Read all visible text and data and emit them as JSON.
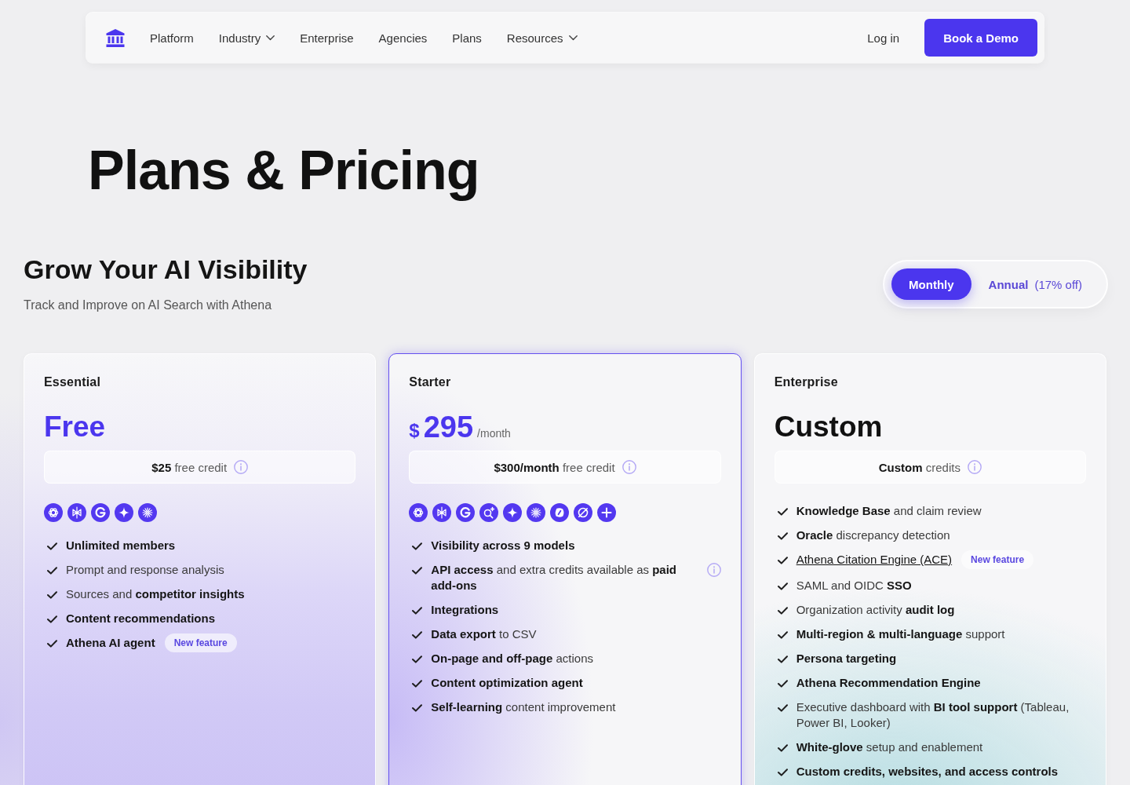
{
  "nav": {
    "links": [
      {
        "label": "Platform",
        "has_menu": false
      },
      {
        "label": "Industry",
        "has_menu": true
      },
      {
        "label": "Enterprise",
        "has_menu": false
      },
      {
        "label": "Agencies",
        "has_menu": false
      },
      {
        "label": "Plans",
        "has_menu": false
      },
      {
        "label": "Resources",
        "has_menu": true
      }
    ],
    "login": "Log in",
    "cta": "Book a Demo"
  },
  "page_title": "Plans & Pricing",
  "section": {
    "title": "Grow Your AI Visibility",
    "subtitle": "Track and Improve on AI Search with Athena"
  },
  "billing_toggle": [
    {
      "label": "Monthly",
      "selected": true
    },
    {
      "label": "Annual",
      "note": "(17% off)",
      "selected": false
    }
  ],
  "plans": [
    {
      "name": "Essential",
      "highlighted": false,
      "price": {
        "kind": "label",
        "value": "Free",
        "accent": true
      },
      "credit": "**$25** free credit",
      "models": [
        {
          "kind": "knot"
        },
        {
          "kind": "lattice"
        },
        {
          "kind": "g-mark"
        },
        {
          "kind": "star"
        },
        {
          "kind": "burst"
        }
      ],
      "features": [
        {
          "kind": "strong",
          "text": "Unlimited members",
          "info": false
        },
        {
          "kind": "text",
          "text": "Prompt and response analysis",
          "info": false
        },
        {
          "kind": "text",
          "text": "Sources and **competitor insights**",
          "info": false
        },
        {
          "kind": "strong",
          "text": "Content recommendations",
          "info": false
        },
        {
          "kind": "strong",
          "text": "Athena AI agent",
          "info": false,
          "badge": "New feature"
        }
      ]
    },
    {
      "name": "Starter",
      "highlighted": true,
      "price": {
        "kind": "amount",
        "currency": "$",
        "value": "295",
        "period": "/month",
        "accent": true
      },
      "credit": "**$300/month** free credit",
      "models": [
        {
          "kind": "knot"
        },
        {
          "kind": "lattice"
        },
        {
          "kind": "g-mark"
        },
        {
          "kind": "magnifier"
        },
        {
          "kind": "star"
        },
        {
          "kind": "burst"
        },
        {
          "kind": "blob"
        },
        {
          "kind": "slashed"
        },
        {
          "kind": "plus"
        }
      ],
      "features": [
        {
          "kind": "strong",
          "text": "Visibility across 9 models",
          "info": false
        },
        {
          "kind": "text",
          "text": "**API access** and extra credits available as **paid add-ons**",
          "info": true
        },
        {
          "kind": "strong",
          "text": "Integrations",
          "info": false
        },
        {
          "kind": "text",
          "text": "**Data export** to CSV",
          "info": false
        },
        {
          "kind": "text",
          "text": "**On-page and off-page** actions",
          "info": false
        },
        {
          "kind": "strong",
          "text": "Content optimization agent",
          "info": false
        },
        {
          "kind": "text",
          "text": "**Self-learning** content improvement",
          "info": false
        }
      ]
    },
    {
      "name": "Enterprise",
      "highlighted": false,
      "price": {
        "kind": "label",
        "value": "Custom",
        "accent": false
      },
      "credit": "**Custom** credits",
      "features": [
        {
          "kind": "text",
          "text": "**Knowledge Base** and claim review",
          "info": false
        },
        {
          "kind": "text",
          "text": "**Oracle** discrepancy detection",
          "info": false
        },
        {
          "kind": "link",
          "text": "Athena Citation Engine (ACE)",
          "info": false,
          "badge": "New feature"
        },
        {
          "kind": "text",
          "text": "SAML and OIDC **SSO**",
          "info": false
        },
        {
          "kind": "text",
          "text": "Organization activity **audit log**",
          "info": false
        },
        {
          "kind": "text",
          "text": "**Multi-region & multi-language** support",
          "info": false
        },
        {
          "kind": "strong",
          "text": "Persona targeting",
          "info": false
        },
        {
          "kind": "strong",
          "text": "Athena Recommendation Engine",
          "info": false
        },
        {
          "kind": "text",
          "text": "Executive dashboard with **BI tool support** (Tableau, Power BI, Looker)",
          "info": false
        },
        {
          "kind": "text",
          "text": "**White-glove** setup and enablement",
          "info": false
        },
        {
          "kind": "strong",
          "text": "Custom credits, websites, and access controls",
          "info": false
        }
      ]
    }
  ]
}
